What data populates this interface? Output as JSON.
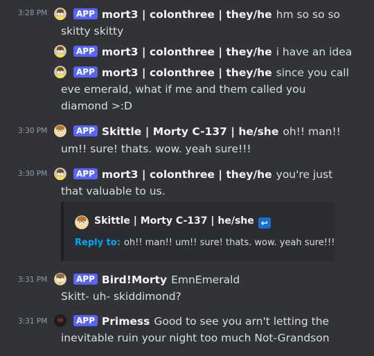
{
  "messages": [
    {
      "timestamp": "3:28 PM",
      "app": "APP",
      "username": "mort3 | colonthree | they/he",
      "text_line1": "hm so so so",
      "text_line2": "skitty skitty"
    },
    {
      "app": "APP",
      "username": "mort3 | colonthree | they/he",
      "text_line1": "i have an idea"
    },
    {
      "app": "APP",
      "username": "mort3 | colonthree | they/he",
      "text_line1": "since you call",
      "text_line2": "eve emerald, what if me and them called you",
      "text_line3": "diamond >:D"
    },
    {
      "timestamp": "3:30 PM",
      "app": "APP",
      "username": "Skittle | Morty C-137 | he/she",
      "text_line1": "oh!! man!!",
      "text_line2": "um!! sure! thats. wow. yeah sure!!!"
    },
    {
      "timestamp": "3:30 PM",
      "app": "APP",
      "username": "mort3 | colonthree | they/he",
      "text_line1": "you're just",
      "text_line2": "that valuable to us."
    },
    {
      "timestamp": "3:31 PM",
      "app": "APP",
      "username": "Bird!Morty",
      "text_line1": "EmnEmerald",
      "text_line2": "Skitt- uh- skiddimond?"
    },
    {
      "timestamp": "3:31 PM",
      "app": "APP",
      "username": "Primess",
      "text_line1": "Good to see you arn't letting the",
      "text_line2": "inevitable ruin your night too much Not-Grandson"
    }
  ],
  "embed": {
    "username": "Skittle | Morty C-137 | he/she",
    "reply_label": "Reply to:",
    "reply_text": "oh!! man!! um!! sure! thats. wow. yeah sure!!!"
  },
  "colors": {
    "background": "#313338",
    "app_badge": "#5865f2",
    "reply_label": "#00a8fc",
    "embed_bg": "#2b2d31"
  }
}
